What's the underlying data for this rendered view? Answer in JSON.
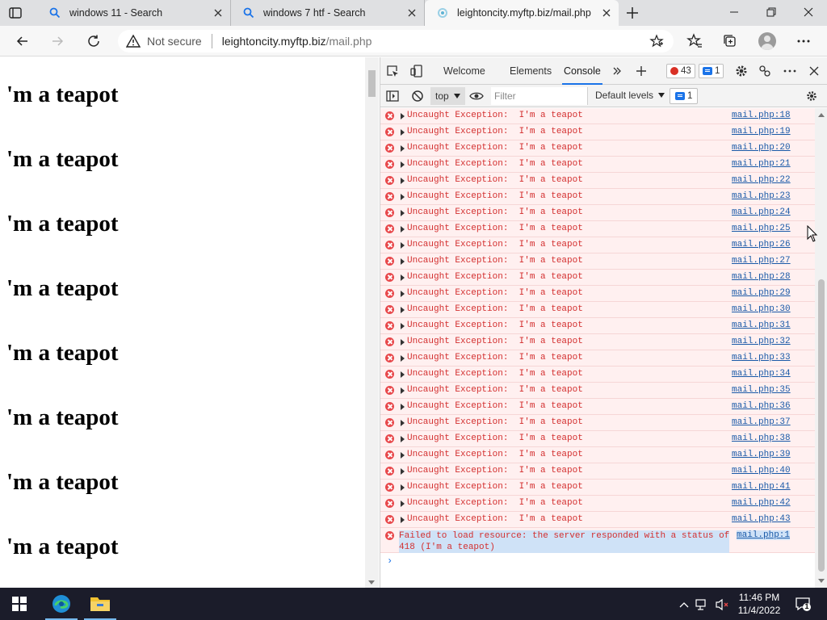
{
  "browser": {
    "tabs": [
      {
        "title": "windows 11 - Search",
        "state": "inactive",
        "icon": "search-icon"
      },
      {
        "title": "windows 7 htf - Search",
        "state": "inactive",
        "icon": "search-icon"
      },
      {
        "title": "leightoncity.myftp.biz/mail.php",
        "state": "active",
        "icon": "loading-icon"
      }
    ],
    "security_label": "Not secure",
    "url_host": "leightoncity.myftp.biz",
    "url_path": "/mail.php"
  },
  "page": {
    "lines": [
      "'m a teapot",
      "'m a teapot",
      "'m a teapot",
      "'m a teapot",
      "'m a teapot",
      "'m a teapot",
      "'m a teapot",
      "'m a teapot"
    ]
  },
  "devtools": {
    "tabs": [
      "Welcome",
      "Elements",
      "Console"
    ],
    "active_tab": "Console",
    "error_count": "43",
    "message_count": "1",
    "context": "top",
    "filter_placeholder": "Filter",
    "levels_label": "Default levels",
    "issues_count": "1",
    "rows": [
      {
        "text": "Uncaught Exception:  I'm a teapot",
        "source": "mail.php:18"
      },
      {
        "text": "Uncaught Exception:  I'm a teapot",
        "source": "mail.php:19"
      },
      {
        "text": "Uncaught Exception:  I'm a teapot",
        "source": "mail.php:20"
      },
      {
        "text": "Uncaught Exception:  I'm a teapot",
        "source": "mail.php:21"
      },
      {
        "text": "Uncaught Exception:  I'm a teapot",
        "source": "mail.php:22"
      },
      {
        "text": "Uncaught Exception:  I'm a teapot",
        "source": "mail.php:23"
      },
      {
        "text": "Uncaught Exception:  I'm a teapot",
        "source": "mail.php:24"
      },
      {
        "text": "Uncaught Exception:  I'm a teapot",
        "source": "mail.php:25"
      },
      {
        "text": "Uncaught Exception:  I'm a teapot",
        "source": "mail.php:26"
      },
      {
        "text": "Uncaught Exception:  I'm a teapot",
        "source": "mail.php:27"
      },
      {
        "text": "Uncaught Exception:  I'm a teapot",
        "source": "mail.php:28"
      },
      {
        "text": "Uncaught Exception:  I'm a teapot",
        "source": "mail.php:29"
      },
      {
        "text": "Uncaught Exception:  I'm a teapot",
        "source": "mail.php:30"
      },
      {
        "text": "Uncaught Exception:  I'm a teapot",
        "source": "mail.php:31"
      },
      {
        "text": "Uncaught Exception:  I'm a teapot",
        "source": "mail.php:32"
      },
      {
        "text": "Uncaught Exception:  I'm a teapot",
        "source": "mail.php:33"
      },
      {
        "text": "Uncaught Exception:  I'm a teapot",
        "source": "mail.php:34"
      },
      {
        "text": "Uncaught Exception:  I'm a teapot",
        "source": "mail.php:35"
      },
      {
        "text": "Uncaught Exception:  I'm a teapot",
        "source": "mail.php:36"
      },
      {
        "text": "Uncaught Exception:  I'm a teapot",
        "source": "mail.php:37"
      },
      {
        "text": "Uncaught Exception:  I'm a teapot",
        "source": "mail.php:38"
      },
      {
        "text": "Uncaught Exception:  I'm a teapot",
        "source": "mail.php:39"
      },
      {
        "text": "Uncaught Exception:  I'm a teapot",
        "source": "mail.php:40"
      },
      {
        "text": "Uncaught Exception:  I'm a teapot",
        "source": "mail.php:41"
      },
      {
        "text": "Uncaught Exception:  I'm a teapot",
        "source": "mail.php:42"
      },
      {
        "text": "Uncaught Exception:  I'm a teapot",
        "source": "mail.php:43"
      }
    ],
    "failed_line1": "Failed to load resource: the server responded with a status of",
    "failed_line2": "418 (I'm a teapot)",
    "failed_source": "mail.php:1",
    "prompt_symbol": "›"
  },
  "taskbar": {
    "time": "11:46 PM",
    "date": "11/4/2022",
    "notification_count": "1"
  },
  "colors": {
    "error_red": "#d32f2f",
    "error_row_bg": "#fff0f0",
    "link_blue": "#1a5aa8",
    "accent_blue": "#1a73e8",
    "taskbar_bg": "#1b1c2a"
  }
}
